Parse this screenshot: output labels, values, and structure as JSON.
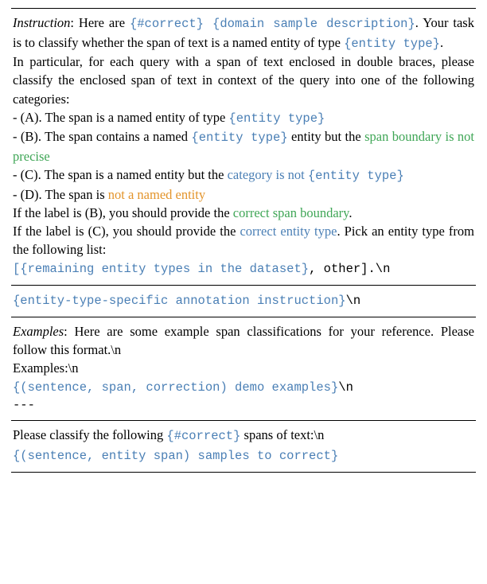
{
  "section1": {
    "instruction_label": "Instruction",
    "instruction_text_1a": ":   Here are ",
    "instruction_placeholder_1": "{#correct} {domain  sample description}",
    "instruction_text_1b": ". Your task is to classify whether the span of text is a named entity of type ",
    "instruction_placeholder_2": "{entity type}",
    "instruction_text_1c": ".",
    "instruction_para2": "In particular, for each query with a span of text enclosed in double braces, please classify the enclosed span of text in context of the query into one of the following categories:",
    "option_a_pre": " - (A). The span is a named entity of type ",
    "option_a_ph": "{entity type}",
    "option_b_pre": " - (B). The span contains a named ",
    "option_b_ph": "{entity type}",
    "option_b_post": " entity but the ",
    "option_b_green": "span boundary is not precise",
    "option_c_pre": " - (C). The span is a named entity but the ",
    "option_c_blue1": "category is not",
    "option_c_blue2": "{entity type}",
    "option_d_pre": " - (D). The span is ",
    "option_d_orange": "not a named entity",
    "label_b_pre": "If the label is (B), you should provide the ",
    "label_b_green": "correct span boundary",
    "label_b_post": ".",
    "label_c_pre": "If the label is (C), you should provide the ",
    "label_c_blue": "correct entity type",
    "label_c_post": ". Pick an entity type from the following list:",
    "remaining_list": "[{remaining entity types in the dataset}",
    "remaining_post": ", other].\\n"
  },
  "section2": {
    "entity_specific": "{entity-type-specific annotation instruction}",
    "newline": "\\n"
  },
  "section3": {
    "examples_label": "Examples",
    "examples_text": ": Here are some example span classifications for your reference.  Please follow this format.\\n",
    "examples_header": "Examples:\\n",
    "examples_ph": "{(sentence, span, correction) demo examples}",
    "examples_nl": "\\n",
    "dashes": "---"
  },
  "section4": {
    "classify_pre": "Please classify the following ",
    "classify_ph": "{#correct}",
    "classify_post": " spans of text:\\n",
    "samples_ph": "{(sentence, entity span) samples to correct}"
  }
}
